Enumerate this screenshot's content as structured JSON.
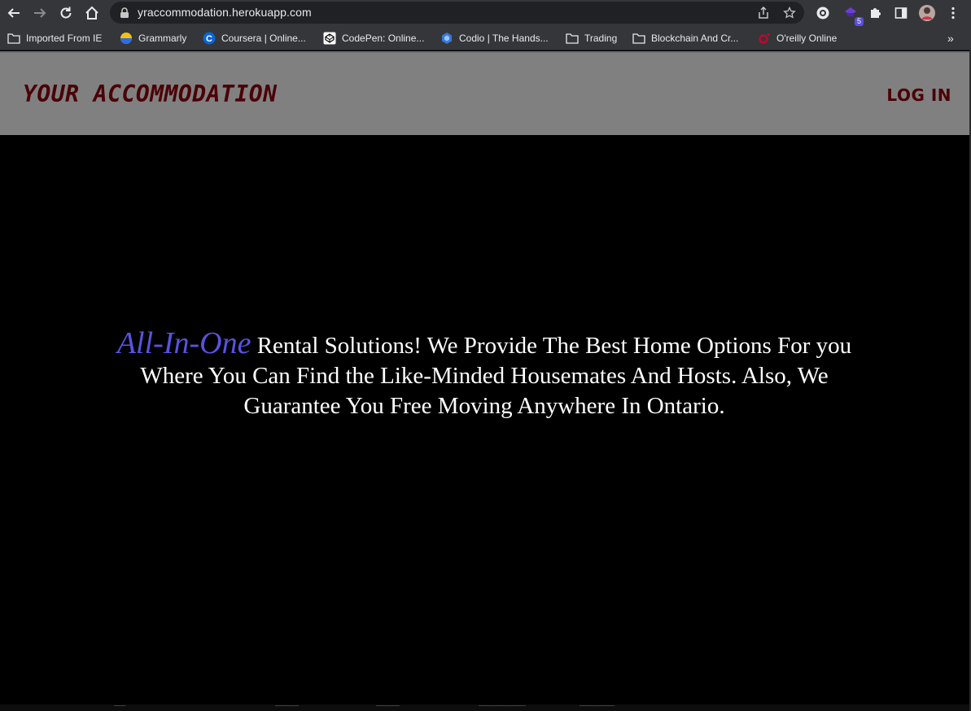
{
  "browser": {
    "url": "yraccommodation.herokuapp.com",
    "extension_badge": "5",
    "bookmarks": [
      {
        "label": "Imported From IE",
        "icon": "folder-icon"
      },
      {
        "label": "Grammarly",
        "icon": "grammarly-icon"
      },
      {
        "label": "Coursera | Online...",
        "icon": "coursera-icon"
      },
      {
        "label": "CodePen: Online...",
        "icon": "codepen-icon"
      },
      {
        "label": "Codio | The Hands...",
        "icon": "codio-icon"
      },
      {
        "label": "Trading",
        "icon": "folder-icon"
      },
      {
        "label": "Blockchain And Cr...",
        "icon": "folder-icon"
      },
      {
        "label": "O'reilly Online",
        "icon": "oreilly-icon"
      }
    ],
    "overflow": "»"
  },
  "header": {
    "brand": "YOUR ACCOMMODATION",
    "login": "LOG IN"
  },
  "hero": {
    "accent": "All-In-One",
    "text": " Rental Solutions! We Provide The Best Home Options For you Where You Can Find the Like-Minded Housemates And Hosts. Also, We Guarantee You Free Moving Anywhere In Ontario."
  },
  "colors": {
    "header_bg": "#808080",
    "brand": "#4a0006",
    "accent": "#5b52e0",
    "hero_bg": "#000000"
  }
}
